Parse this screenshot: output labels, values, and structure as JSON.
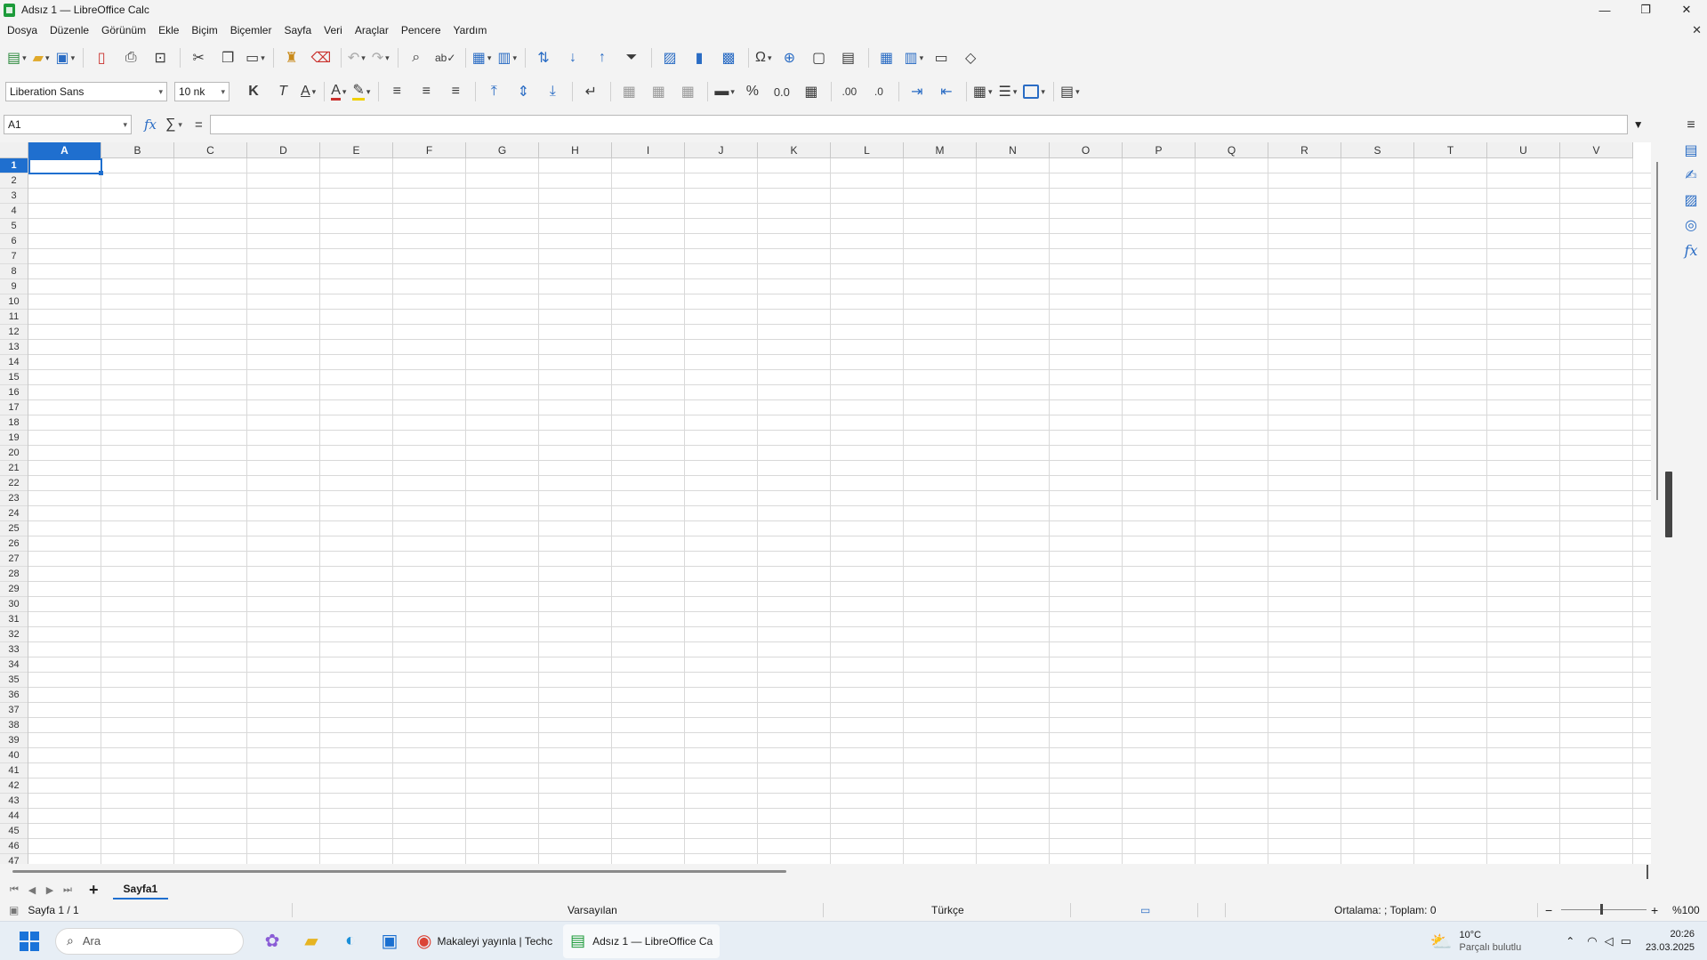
{
  "window": {
    "title": "Adsız 1 — LibreOffice Calc",
    "minimize": "—",
    "maximize": "❐",
    "close": "✕",
    "doc_close": "✕"
  },
  "menu": [
    "Dosya",
    "Düzenle",
    "Görünüm",
    "Ekle",
    "Biçim",
    "Biçemler",
    "Sayfa",
    "Veri",
    "Araçlar",
    "Pencere",
    "Yardım"
  ],
  "formatting": {
    "font_name": "Liberation Sans",
    "font_size": "10 nk",
    "bold": "K",
    "italic": "T",
    "underline": "A",
    "percent": "%",
    "number": "0.0",
    "add_decimal": ".00",
    "remove_decimal": ".0"
  },
  "formula_bar": {
    "cell_ref": "A1",
    "fx": "fx",
    "sigma": "∑",
    "equals": "=",
    "content": ""
  },
  "grid": {
    "columns": [
      "A",
      "B",
      "C",
      "D",
      "E",
      "F",
      "G",
      "H",
      "I",
      "J",
      "K",
      "L",
      "M",
      "N",
      "O",
      "P",
      "Q",
      "R",
      "S",
      "T",
      "U",
      "V"
    ],
    "rows": [
      "1",
      "2",
      "3",
      "4",
      "5",
      "6",
      "7",
      "8",
      "9",
      "10",
      "11",
      "12",
      "13",
      "14",
      "15",
      "16",
      "17",
      "18",
      "19",
      "20",
      "21",
      "22",
      "23",
      "24",
      "25",
      "26",
      "27",
      "28",
      "29",
      "30",
      "31",
      "32",
      "33",
      "34",
      "35",
      "36",
      "37",
      "38",
      "39",
      "40",
      "41",
      "42",
      "43",
      "44",
      "45",
      "46",
      "47"
    ],
    "selected_cell": "A1"
  },
  "sheets": {
    "tabs": [
      "Sayfa1"
    ],
    "add": "+"
  },
  "status": {
    "sheet": "Sayfa 1 / 1",
    "style": "Varsayılan",
    "language": "Türkçe",
    "summary": "Ortalama: ; Toplam: 0",
    "zoom_minus": "−",
    "zoom_plus": "+",
    "zoom_level": "%100"
  },
  "taskbar": {
    "search_placeholder": "Ara",
    "chrome_window": "Makaleyi yayınla | Techc",
    "calc_window": "Adsız 1 — LibreOffice Ca",
    "weather_temp": "10°C",
    "weather_desc": "Parçalı bulutlu",
    "time": "20:26",
    "date": "23.03.2025"
  }
}
